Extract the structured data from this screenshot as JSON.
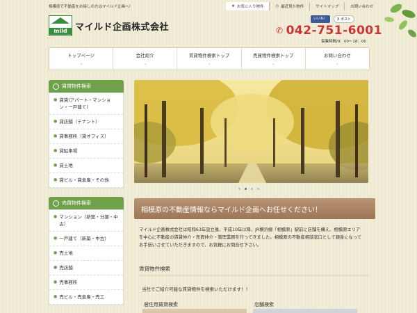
{
  "header": {
    "tagline": "相模原で不動産をお探しの方はマイルド企画へ！",
    "top_links": [
      "お気に入り物件",
      "最近見た物件",
      "サイトマップ",
      "お問い合わせ"
    ],
    "logo_text": "mild",
    "company_name": "マイルド企画株式会社",
    "social": {
      "facebook": "いいね！",
      "twitter": "X ポスト"
    },
    "phone": "042-751-6001",
    "hours": "営業時間/9：00～18：00"
  },
  "nav": {
    "items": [
      "トップページ",
      "会社紹介",
      "賃貸物件検索トップ",
      "売買物件検索トップ",
      "お問い合わせ"
    ]
  },
  "sidebar": {
    "rental": {
      "title": "賃貸物件検索",
      "items": [
        "貸貸(アパート・マンション・一戸建て)",
        "貸店舗（テナント）",
        "貸事務所（貸オフィス）",
        "貸駐車場",
        "貸土地",
        "貸ビル・貸倉庫・その他"
      ]
    },
    "sale": {
      "title": "売買物件検索",
      "items": [
        "マンション（新築・分譲・中古）",
        "一戸建て（新築・中古）",
        "売土地",
        "売店舗",
        "売事務所",
        "売ビル・売倉庫・売工"
      ]
    }
  },
  "main": {
    "banner": "相模原の不動産情報ならマイルド企画へお任せください！",
    "intro": "マイルド企画株式会社は昭和63年設立後、平成10年以降、JR横浜線「相模原」駅前に店舗を構え、相模原エリアを中心に不動産の賃貸仲介・売買仲介・管理業務を行ってきました。相模原の不動産相談窓口として親身になってお手伝いさせていただきますので、お気軽にお問合せ下さい。",
    "section_title": "賃貸物件検索",
    "section_sub": "当社でご紹介可能な賃貸物件を検索いただけます！！",
    "cards": [
      "居住用賃貸検索",
      "店舗検索"
    ]
  },
  "colors": {
    "accent_green": "#6ea14a",
    "phone_red": "#cc3333",
    "banner_brown": "#a67f5e"
  },
  "slider": {
    "total": 4,
    "active": 2
  }
}
